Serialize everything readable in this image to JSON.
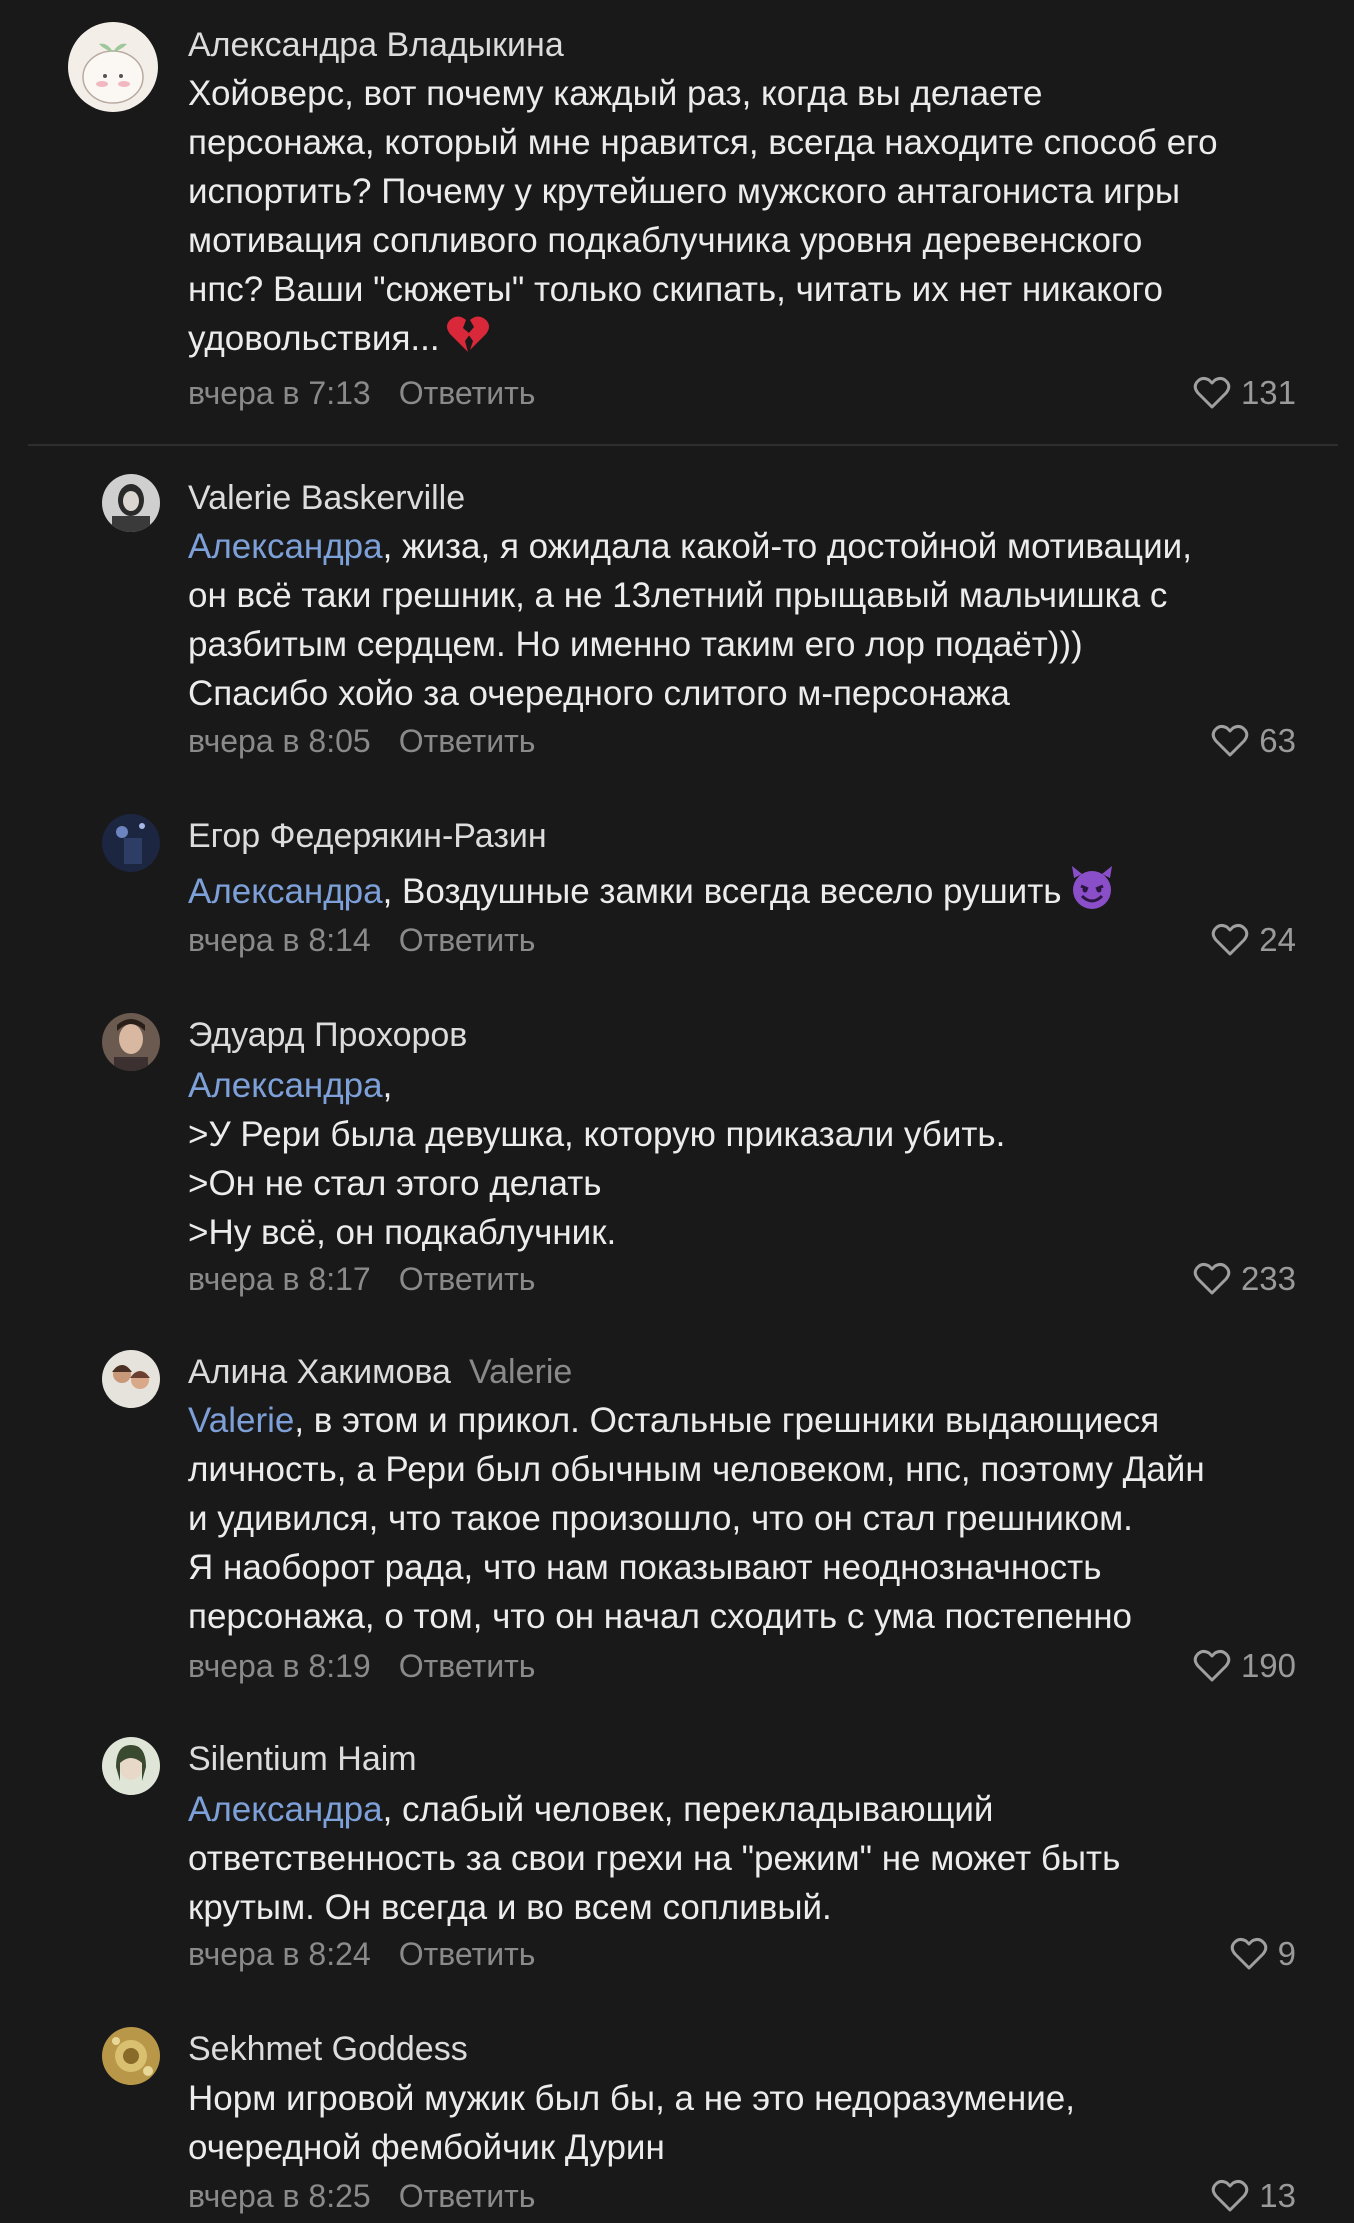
{
  "comments": [
    {
      "author": "Александра Владыкина",
      "lines": [
        "Хойоверс, вот почему каждый раз, когда вы делаете",
        "персонажа, который мне нравится, всегда находите способ его",
        "испортить? Почему у крутейшего мужского антагониста игры",
        "мотивация сопливого подкаблучника уровня деревенского",
        "нпс? Ваши \"сюжеты\" только скипать, читать их нет никакого",
        "удовольствия..."
      ],
      "emoji": "broken-heart-icon",
      "time": "вчера в 7:13",
      "reply_label": "Ответить",
      "likes": "131"
    },
    {
      "author": "Valerie Baskerville",
      "mention": "Александра",
      "lines": [
        ", жиза, я ожидала какой-то достойной мотивации,",
        "он всё таки грешник, а не 13летний прыщавый мальчишка с",
        "разбитым сердцем. Но именно таким его лор подаёт)))",
        "Спасибо хойо за очередного слитого м-персонажа"
      ],
      "time": "вчера в 8:05",
      "reply_label": "Ответить",
      "likes": "63"
    },
    {
      "author": "Егор Федерякин-Разин",
      "mention": "Александра",
      "lines": [
        ", Воздушные замки всегда весело рушить"
      ],
      "emoji": "smiling-devil-icon",
      "time": "вчера в 8:14",
      "reply_label": "Ответить",
      "likes": "24"
    },
    {
      "author": "Эдуард Прохоров",
      "mention": "Александра",
      "lines": [
        ",",
        ">У Рери была девушка, которую приказали убить.",
        ">Он не стал этого делать",
        ">Ну всё, он подкаблучник."
      ],
      "time": "вчера в 8:17",
      "reply_label": "Ответить",
      "likes": "233"
    },
    {
      "author": "Алина Хакимова",
      "reply_to": "Valerie",
      "mention": "Valerie",
      "lines": [
        ", в этом и прикол. Остальные грешники выдающиеся",
        "личность, а Рери был обычным человеком, нпс, поэтому Дайн",
        "и удивился, что такое произошло, что он стал грешником.",
        "Я наоборот рада, что нам показывают неоднозначность",
        "персонажа, о том, что он начал сходить с ума постепенно"
      ],
      "time": "вчера в 8:19",
      "reply_label": "Ответить",
      "likes": "190"
    },
    {
      "author": "Silentium Haim",
      "mention": "Александра",
      "lines": [
        ", слабый человек, перекладывающий",
        "ответственность за свои грехи на \"режим\" не может быть",
        "крутым. Он всегда и во всем сопливый."
      ],
      "time": "вчера в 8:24",
      "reply_label": "Ответить",
      "likes": "9"
    },
    {
      "author": "Sekhmet Goddess",
      "lines": [
        "Норм игровой мужик был бы, а не это недоразумение,",
        "очередной фембойчик Дурин"
      ],
      "time": "вчера в 8:25",
      "reply_label": "Ответить",
      "likes": "13"
    }
  ]
}
